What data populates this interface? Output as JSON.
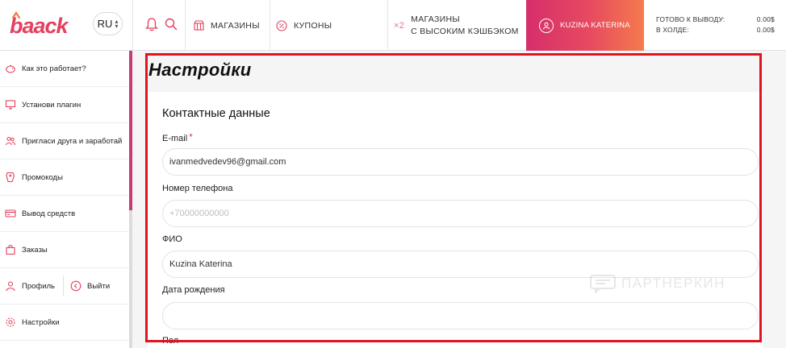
{
  "brand": {
    "logo": "baack",
    "accent": "#e4405f",
    "gradient_from": "#d62e6b",
    "gradient_to": "#f57b4d"
  },
  "header": {
    "lang": "RU",
    "icons": [
      "bell-icon",
      "search-icon"
    ],
    "nav": {
      "shops": "МАГАЗИНЫ",
      "coupons": "КУПОНЫ",
      "cashback_badge": "×2",
      "cashback_line1": "МАГАЗИНЫ",
      "cashback_line2": "С ВЫСОКИМ КЭШБЭКОМ"
    },
    "user": "KUZINA KATERINA",
    "balance": {
      "withdraw_label": "ГОТОВО К ВЫВОДУ:",
      "withdraw_value": "0.00$",
      "hold_label": "В ХОЛДЕ:",
      "hold_value": "0.00$"
    }
  },
  "sidebar": {
    "items": [
      {
        "label": "Как это работает?",
        "icon": "piggy-icon"
      },
      {
        "label": "Установи плагин",
        "icon": "monitor-icon"
      },
      {
        "label": "Пригласи друга и заработай",
        "icon": "friends-icon"
      },
      {
        "label": "Промокоды",
        "icon": "tag-icon"
      },
      {
        "label": "Вывод средств",
        "icon": "card-icon"
      },
      {
        "label": "Заказы",
        "icon": "bag-icon"
      }
    ],
    "profile": "Профиль",
    "logout": "Выйти",
    "settings": "Настройки"
  },
  "main": {
    "title": "Настройки",
    "section": "Контактные данные",
    "fields": {
      "email_label": "E-mail",
      "email_required": "*",
      "email_value": "ivanmedvedev96@gmail.com",
      "phone_label": "Номер телефона",
      "phone_placeholder": "+70000000000",
      "name_label": "ФИО",
      "name_value": "Kuzina Katerina",
      "birth_label": "Дата рождения",
      "birth_value": "",
      "gender_label": "Пол"
    }
  },
  "watermark": "ПАРТНЕРКИН",
  "annotation_color": "#e0131f"
}
